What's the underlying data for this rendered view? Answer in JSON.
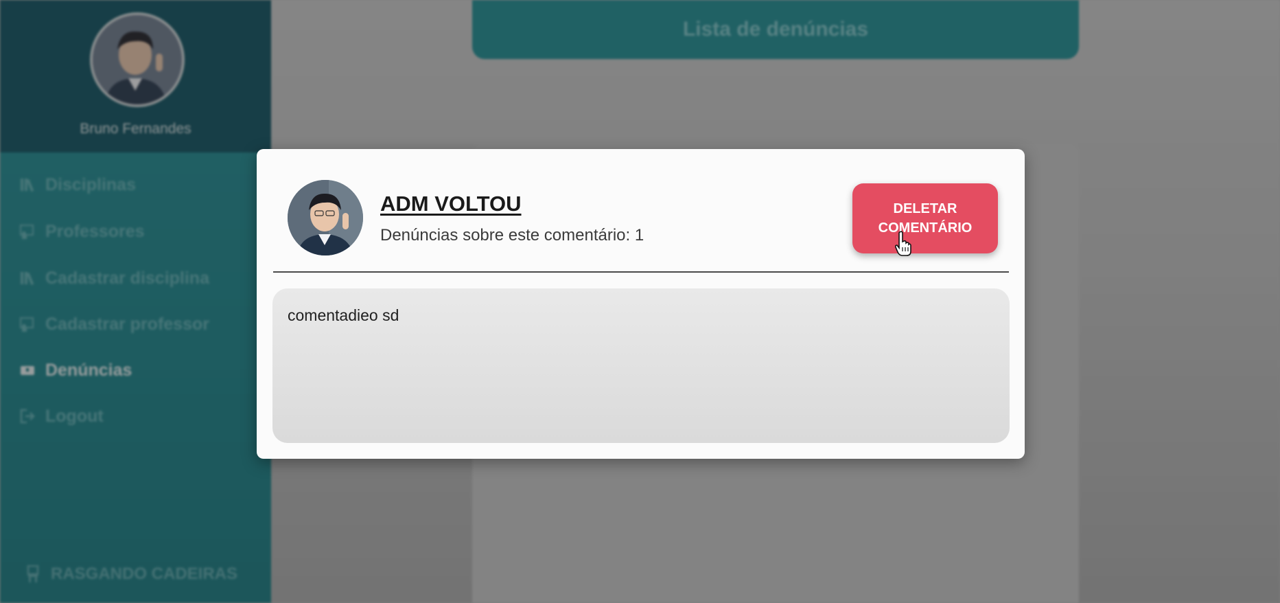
{
  "sidebar": {
    "user_name": "Bruno Fernandes",
    "items": [
      {
        "label": "Disciplinas",
        "icon": "books-icon"
      },
      {
        "label": "Professores",
        "icon": "teacher-icon"
      },
      {
        "label": "Cadastrar disciplina",
        "icon": "books-icon"
      },
      {
        "label": "Cadastrar professor",
        "icon": "teacher-icon"
      },
      {
        "label": "Denúncias",
        "icon": "report-icon",
        "active": true
      },
      {
        "label": "Logout",
        "icon": "logout-icon"
      }
    ],
    "brand": "RASGANDO CADEIRAS"
  },
  "main": {
    "header_title": "Lista de denúncias"
  },
  "modal": {
    "user_name": "ADM VOLTOU",
    "report_count_text": "Denúncias sobre este comentário: 1",
    "delete_line1": "DELETAR",
    "delete_line2": "COMENTÁRIO",
    "comment_text": "comentadieo sd"
  },
  "colors": {
    "sidebar_teal": "#178188",
    "profile_dark": "#0b4e5d",
    "delete_red": "#e44d61"
  }
}
